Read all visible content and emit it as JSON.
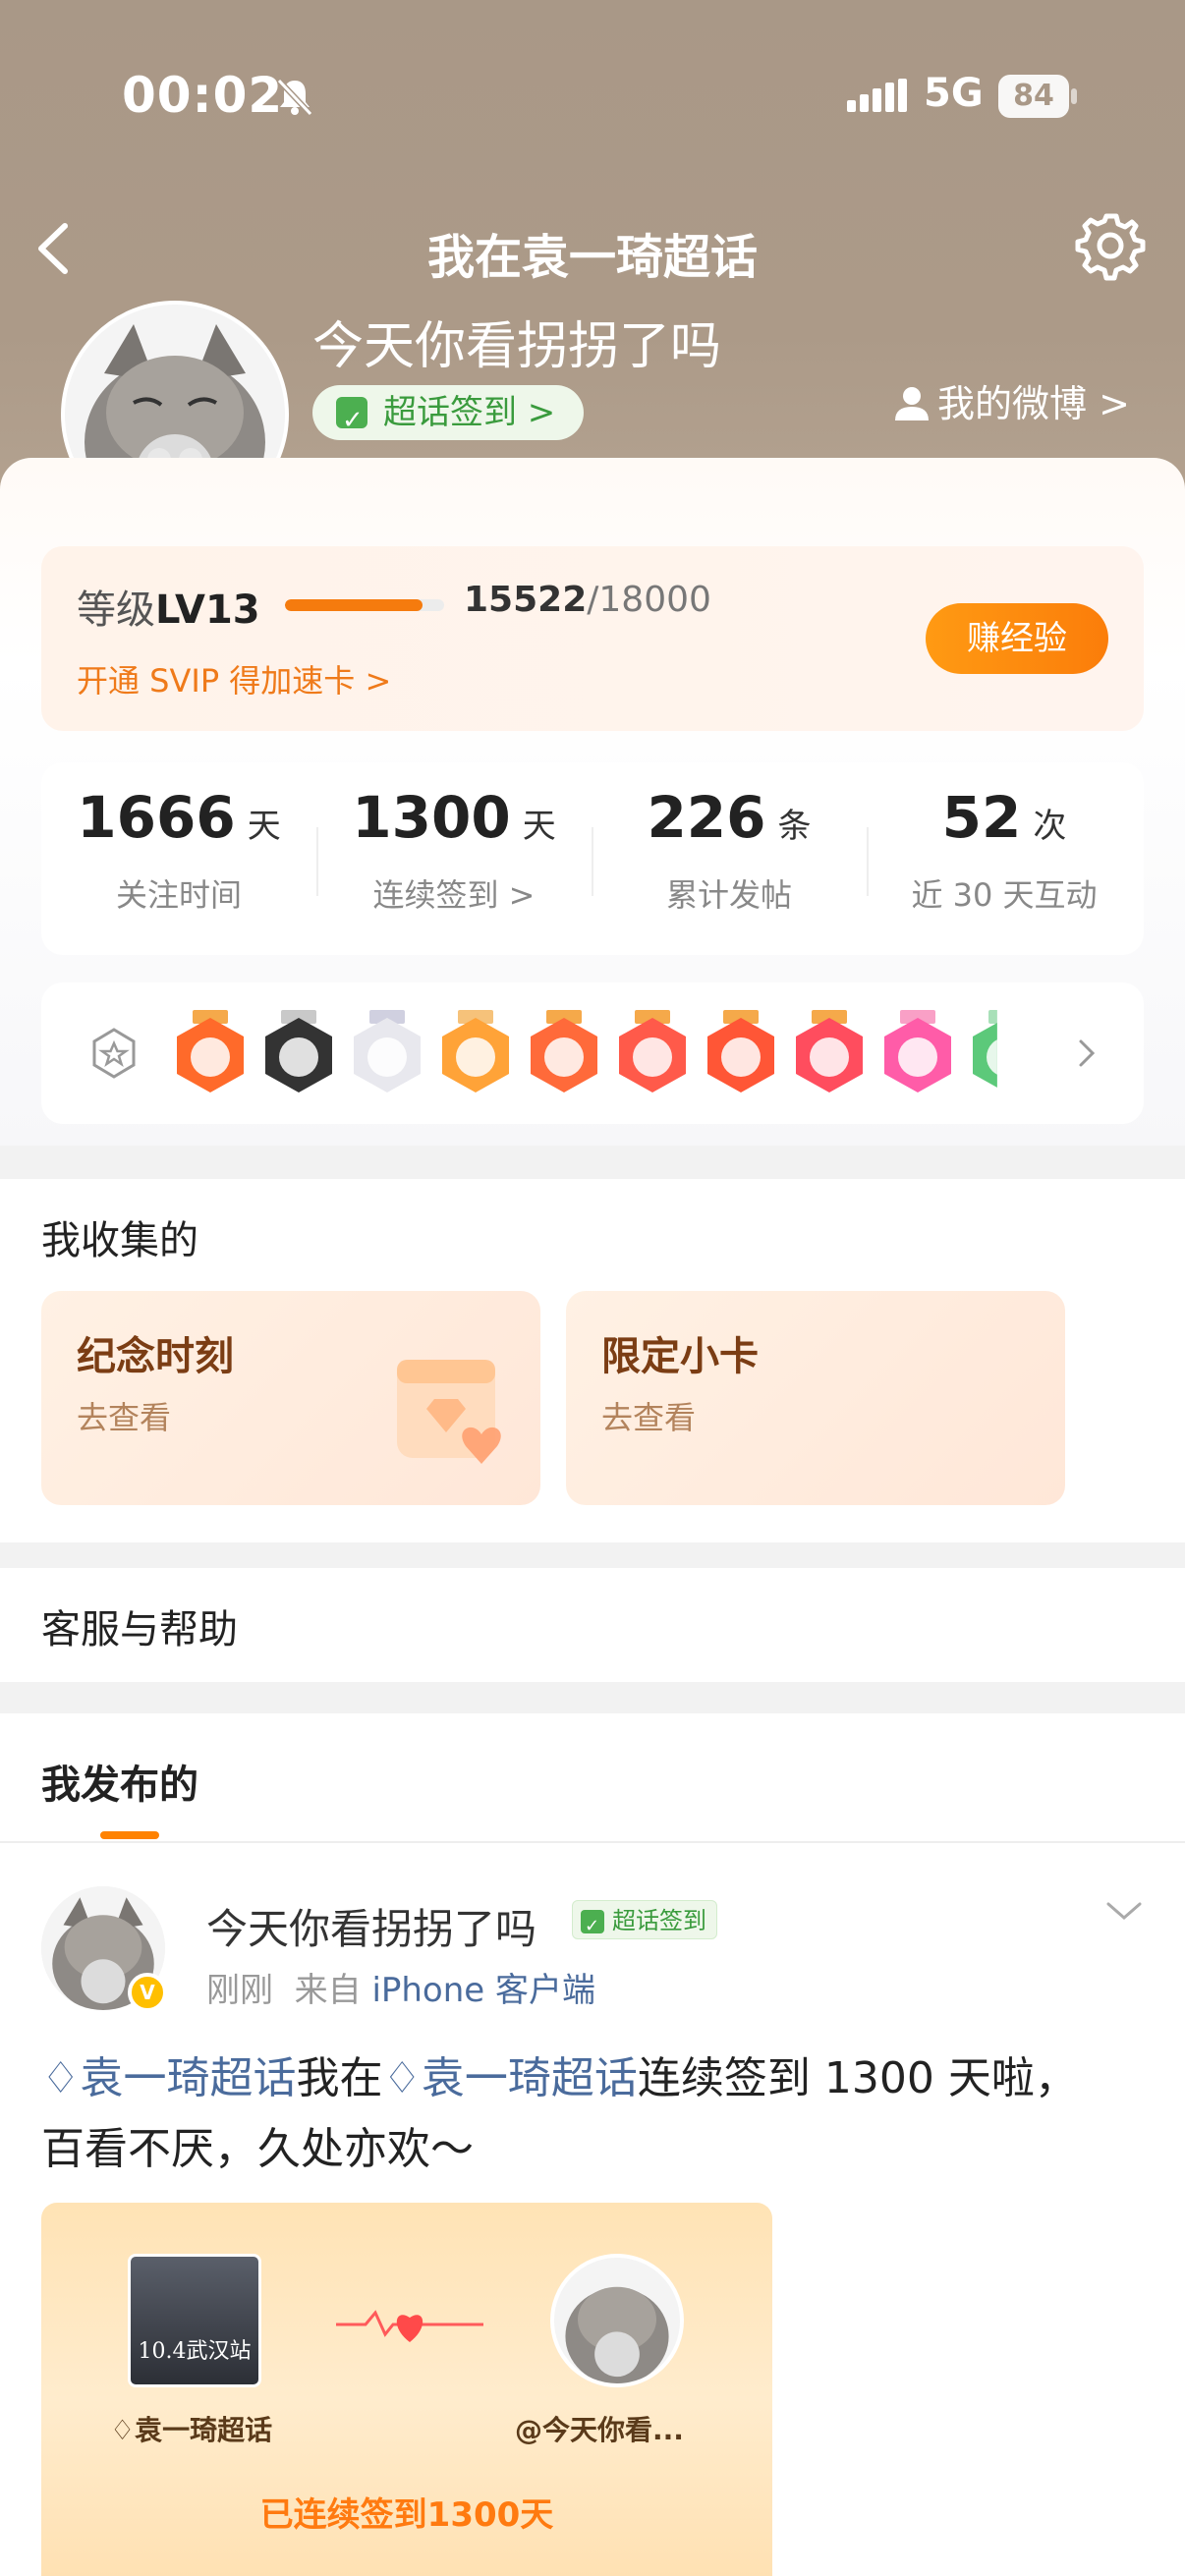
{
  "status_bar": {
    "time": "00:02",
    "network": "5G",
    "battery": "84"
  },
  "header": {
    "title": "我在袁一琦超话",
    "user_name": "今天你看拐拐了吗",
    "checkin_label": "超话签到 >",
    "my_weibo": "我的微博 >"
  },
  "level": {
    "prefix": "等级",
    "level": "LV13",
    "current": "15522",
    "total": "/18000",
    "progress_fraction": 0.862,
    "svip_link": "开通 SVIP 得加速卡 >",
    "earn_button": "赚经验"
  },
  "stats": [
    {
      "num": "1666",
      "unit": "天",
      "label": "关注时间"
    },
    {
      "num": "1300",
      "unit": "天",
      "label": "连续签到 >"
    },
    {
      "num": "226",
      "unit": "条",
      "label": "累计发帖"
    },
    {
      "num": "52",
      "unit": "次",
      "label": "近 30 天互动"
    }
  ],
  "medals": [
    {
      "icon": "100-days-medal",
      "color": "#ff6a2a",
      "ribbon": "#f5a94a"
    },
    {
      "icon": "clapperboard-medal",
      "color": "#333333",
      "ribbon": "#c9c9c9"
    },
    {
      "icon": "girl-figure-medal",
      "color": "#e8e8ee",
      "ribbon": "#d0d0e0"
    },
    {
      "icon": "crown-medal",
      "color": "#ffa338",
      "ribbon": "#f6c27a"
    },
    {
      "icon": "fox-medal",
      "color": "#ff6a3a",
      "ribbon": "#f5a94a"
    },
    {
      "icon": "cat-medal",
      "color": "#ff5a4a",
      "ribbon": "#f5a94a"
    },
    {
      "icon": "dragon-medal",
      "color": "#ff5636",
      "ribbon": "#f5a94a"
    },
    {
      "icon": "rabbit-medal",
      "color": "#ff4d5e",
      "ribbon": "#f5a94a"
    },
    {
      "icon": "lv13-medal",
      "color": "#ff5ca8",
      "ribbon": "#f9a0c6"
    },
    {
      "icon": "green-medal",
      "color": "#5cc97a",
      "ribbon": "#a8e0b8"
    }
  ],
  "collections": {
    "title": "我收集的",
    "items": [
      {
        "title": "纪念时刻",
        "sub": "去查看"
      },
      {
        "title": "限定小卡",
        "sub": "去查看"
      }
    ]
  },
  "help": {
    "title": "客服与帮助"
  },
  "posts_tab": {
    "label": "我发布的"
  },
  "post": {
    "author": "今天你看拐拐了吗",
    "tag": "超话签到",
    "time": "刚刚",
    "from_prefix": "来自",
    "source": "iPhone 客户端",
    "topic1": "袁一琦超话",
    "text1": "我在",
    "topic2": "袁一琦超话",
    "text2": "连续签到 1300 天啦，百看不厌，久处亦欢～",
    "share": {
      "poster_text": "10.4武汉站",
      "left_label": "袁一琦超话",
      "right_label": "@今天你看...",
      "bottom": "已连续签到1300天"
    }
  },
  "colors": {
    "accent": "#ff8200",
    "topic": "#4a6b9c",
    "checkin_green": "#3a9b3d"
  }
}
